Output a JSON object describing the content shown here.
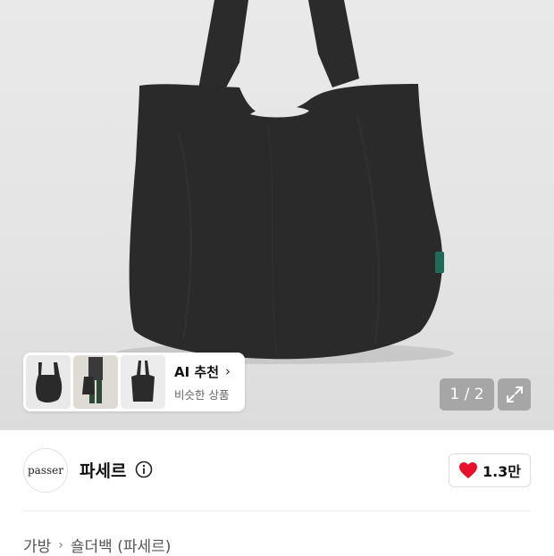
{
  "product_image": {
    "pager_text": "1 / 2",
    "expand_icon": "expand-arrows-icon"
  },
  "ai_recommend": {
    "title": "AI 추천",
    "subtitle": "비슷한 상품",
    "chevron": "›"
  },
  "brand": {
    "logo_text": "passer",
    "name": "파세르",
    "info_icon": "info-icon"
  },
  "like": {
    "count": "1.3만",
    "color": "#e8112d"
  },
  "breadcrumb": {
    "category": "가방",
    "separator": "›",
    "subcategory": "숄더백 (파세르)"
  }
}
